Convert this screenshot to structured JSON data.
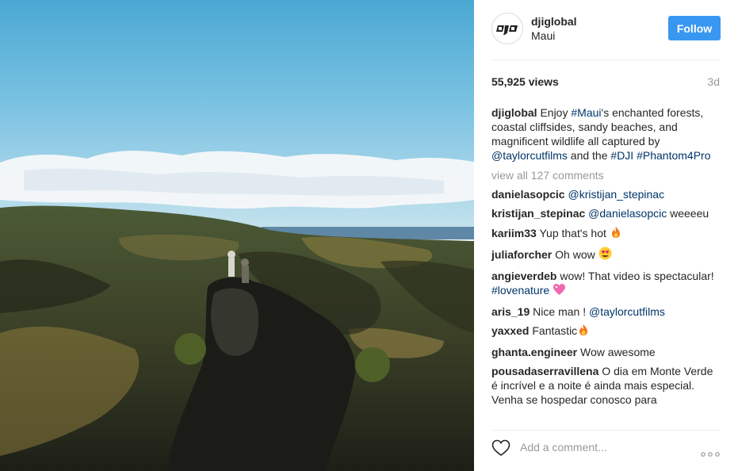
{
  "post": {
    "username": "djiglobal",
    "location": "Maui",
    "follow_label": "Follow",
    "views": "55,925 views",
    "age": "3d"
  },
  "caption": {
    "username": "djiglobal",
    "t1": " Enjoy ",
    "tag_maui": "#Maui",
    "t2": "'s enchanted forests, coastal cliffsides, sandy beaches, and magnificent wildlife all captured by ",
    "mention": "@taylorcutfilms",
    "t3": " and the ",
    "tag_dji": "#DJI",
    "t4": " ",
    "tag_phantom": "#Phantom4Pro"
  },
  "view_all": "view all 127 comments",
  "comments": [
    {
      "user": "danielasopcic",
      "mention": "@kristijan_stepinac",
      "text": ""
    },
    {
      "user": "kristijan_stepinac",
      "mention": "@danielasopcic",
      "text": " weeeeu"
    },
    {
      "user": "kariim33",
      "text": "Yup that's hot "
    },
    {
      "user": "juliaforcher",
      "text": "Oh wow "
    },
    {
      "user": "angieverdeb",
      "text": "wow! That video is spectacular! ",
      "tag": "#lovenature"
    },
    {
      "user": "aris_19",
      "text": "Nice man ! ",
      "mention": "@taylorcutfilms"
    },
    {
      "user": "yaxxed",
      "text": "Fantastic"
    },
    {
      "user": "ghanta.engineer",
      "text": "Wow awesome"
    },
    {
      "user": "pousadaserravillena",
      "text": "O dia em Monte Verde é incrível e a noite é ainda mais especial. Venha se hospedar conosco para"
    }
  ],
  "footer": {
    "add_comment_placeholder": "Add a comment..."
  },
  "icons": {
    "avatar": "dji-logo-icon",
    "heart": "heart-icon",
    "more": "more-options-icon",
    "fire": "fire-emoji-icon",
    "heart_eyes": "heart-eyes-emoji-icon",
    "pink_heart": "sparkling-heart-emoji-icon"
  },
  "colors": {
    "follow_button": "#3897f0",
    "link": "#003569",
    "muted": "#999999"
  }
}
